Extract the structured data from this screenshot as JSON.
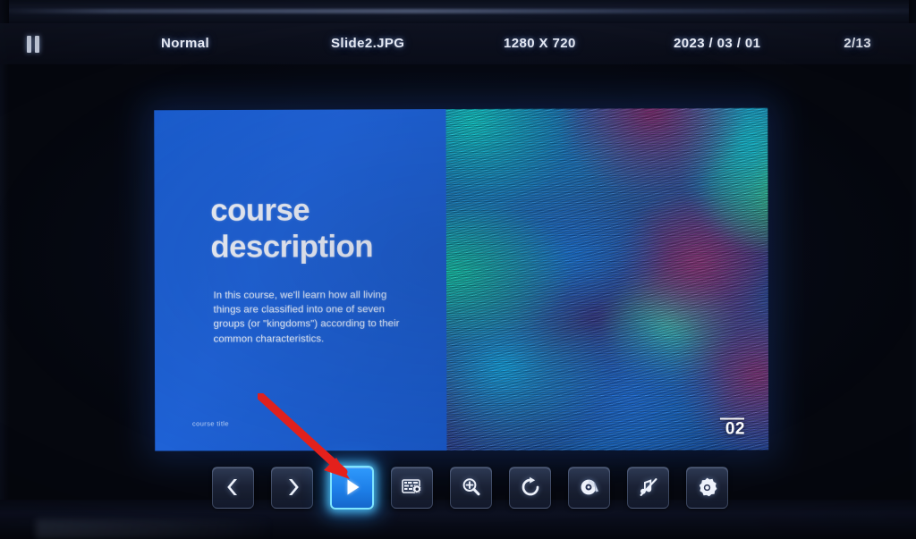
{
  "device": {
    "type": "photo-of-monitor-screen",
    "bezel_color": "#0a0e1a"
  },
  "osd": {
    "playback_state_icon": "pause-icon",
    "mode": "Normal",
    "file_name": "Slide2.JPG",
    "resolution": "1280 X 720",
    "date": "2023 / 03 / 01",
    "counter": "2/13"
  },
  "slide": {
    "title": "course\ndescription",
    "body": "In this course, we'll learn how all living things are classified into one of seven groups (or \"kingdoms\") according to their common characteristics.",
    "footer_label": "course title",
    "page_number": "02",
    "panel_color": "#1f62d6",
    "text_color": "#f2f3f8"
  },
  "toolbar": {
    "accent_color": "#2f9bff",
    "glow_color": "#7fe6ff",
    "buttons": [
      {
        "name": "previous-button",
        "icon": "chevron-left-icon",
        "label": "Previous",
        "active": false
      },
      {
        "name": "next-button",
        "icon": "chevron-right-icon",
        "label": "Next",
        "active": false
      },
      {
        "name": "play-button",
        "icon": "play-icon",
        "label": "Play",
        "active": true
      },
      {
        "name": "slideshow-settings-button",
        "icon": "slideshow-grid-gear-icon",
        "label": "Slideshow Settings",
        "active": false
      },
      {
        "name": "zoom-in-button",
        "icon": "magnifier-plus-icon",
        "label": "Zoom In",
        "active": false
      },
      {
        "name": "rotate-button",
        "icon": "rotate-clockwise-icon",
        "label": "Rotate",
        "active": false
      },
      {
        "name": "disc-button",
        "icon": "disc-icon",
        "label": "Disc",
        "active": false
      },
      {
        "name": "music-off-button",
        "icon": "music-note-slash-icon",
        "label": "Music Off",
        "active": false
      },
      {
        "name": "settings-button",
        "icon": "gear-icon",
        "label": "Settings",
        "active": false
      }
    ]
  },
  "annotation": {
    "arrow_color": "#e8201a",
    "points_to": "play-button"
  }
}
